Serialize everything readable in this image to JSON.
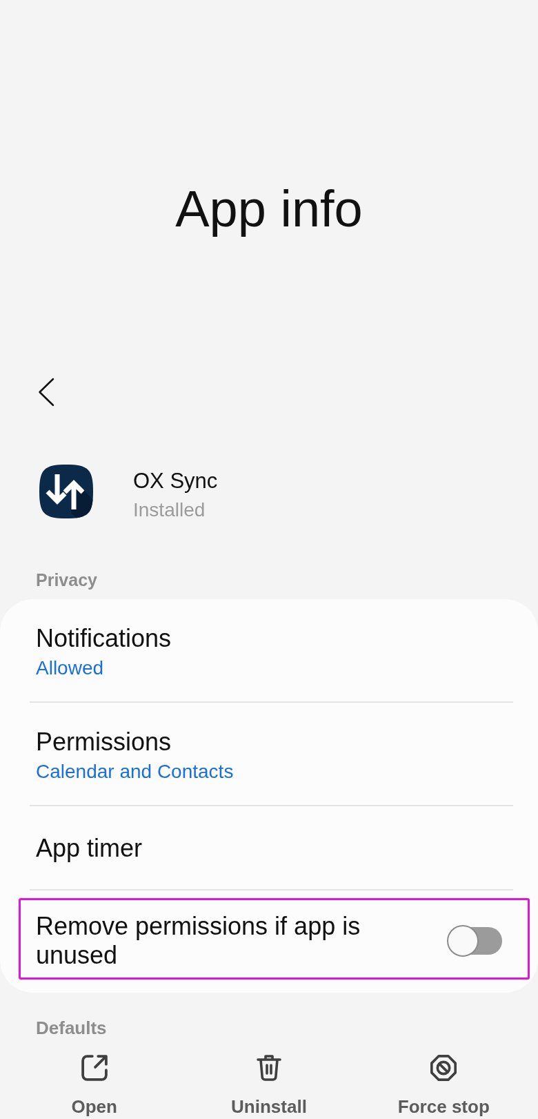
{
  "header": {
    "title": "App info"
  },
  "app": {
    "name": "OX Sync",
    "status": "Installed"
  },
  "privacy": {
    "label": "Privacy",
    "items": [
      {
        "kind": "link",
        "title": "Notifications",
        "value": "Allowed",
        "highlighted": false
      },
      {
        "kind": "link",
        "title": "Permissions",
        "value": "Calendar and Contacts",
        "highlighted": false
      },
      {
        "kind": "link",
        "title": "App timer",
        "highlighted": false
      },
      {
        "kind": "toggle",
        "title": "Remove permissions if app is unused",
        "on": false,
        "highlighted": true
      }
    ]
  },
  "defaults": {
    "label": "Defaults"
  },
  "actions": [
    {
      "kind": "open",
      "label": "Open"
    },
    {
      "kind": "uninstall",
      "label": "Uninstall"
    },
    {
      "kind": "stop",
      "label": "Force stop"
    }
  ]
}
